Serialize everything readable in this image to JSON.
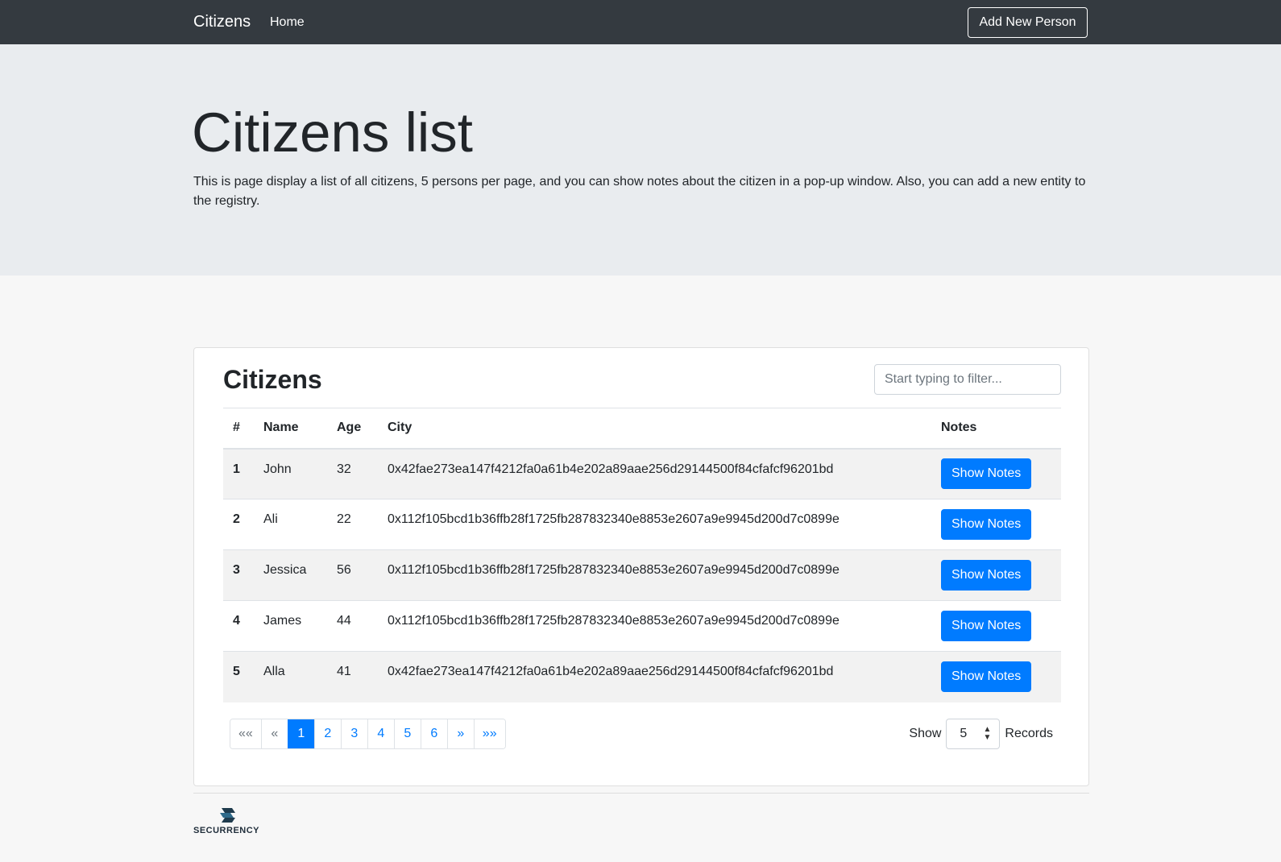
{
  "navbar": {
    "brand": "Citizens",
    "home": "Home",
    "add_button": "Add New Person"
  },
  "jumbotron": {
    "title": "Citizens list",
    "lead": "This is page display a list of all citizens, 5 persons per page, and you can show notes about the citizen in a pop-up window. Also, you can add a new entity to the registry."
  },
  "card": {
    "title": "Citizens",
    "filter_placeholder": "Start typing to filter..."
  },
  "table": {
    "headers": [
      "#",
      "Name",
      "Age",
      "City",
      "Notes"
    ],
    "rows": [
      {
        "index": "1",
        "name": "John",
        "age": "32",
        "city": "0x42fae273ea147f4212fa0a61b4e202a89aae256d29144500f84cfafcf96201bd",
        "button": "Show Notes"
      },
      {
        "index": "2",
        "name": "Ali",
        "age": "22",
        "city": "0x112f105bcd1b36ffb28f1725fb287832340e8853e2607a9e9945d200d7c0899e",
        "button": "Show Notes"
      },
      {
        "index": "3",
        "name": "Jessica",
        "age": "56",
        "city": "0x112f105bcd1b36ffb28f1725fb287832340e8853e2607a9e9945d200d7c0899e",
        "button": "Show Notes"
      },
      {
        "index": "4",
        "name": "James",
        "age": "44",
        "city": "0x112f105bcd1b36ffb28f1725fb287832340e8853e2607a9e9945d200d7c0899e",
        "button": "Show Notes"
      },
      {
        "index": "5",
        "name": "Alla",
        "age": "41",
        "city": "0x42fae273ea147f4212fa0a61b4e202a89aae256d29144500f84cfafcf96201bd",
        "button": "Show Notes"
      }
    ]
  },
  "pagination": {
    "first": "««",
    "prev": "«",
    "pages": [
      "1",
      "2",
      "3",
      "4",
      "5",
      "6"
    ],
    "next": "»",
    "last": "»»",
    "current_page": "1"
  },
  "records": {
    "show_label": "Show",
    "value": "5",
    "records_label": "Records"
  },
  "footer": {
    "logo_text": "SECURRENCY",
    "logo_icon": "securrency-logo-icon"
  },
  "colors": {
    "navbar_bg": "#343a40",
    "jumbotron_bg": "#e9ecef",
    "primary": "#007bff",
    "page_bg": "#f7f7f7"
  }
}
